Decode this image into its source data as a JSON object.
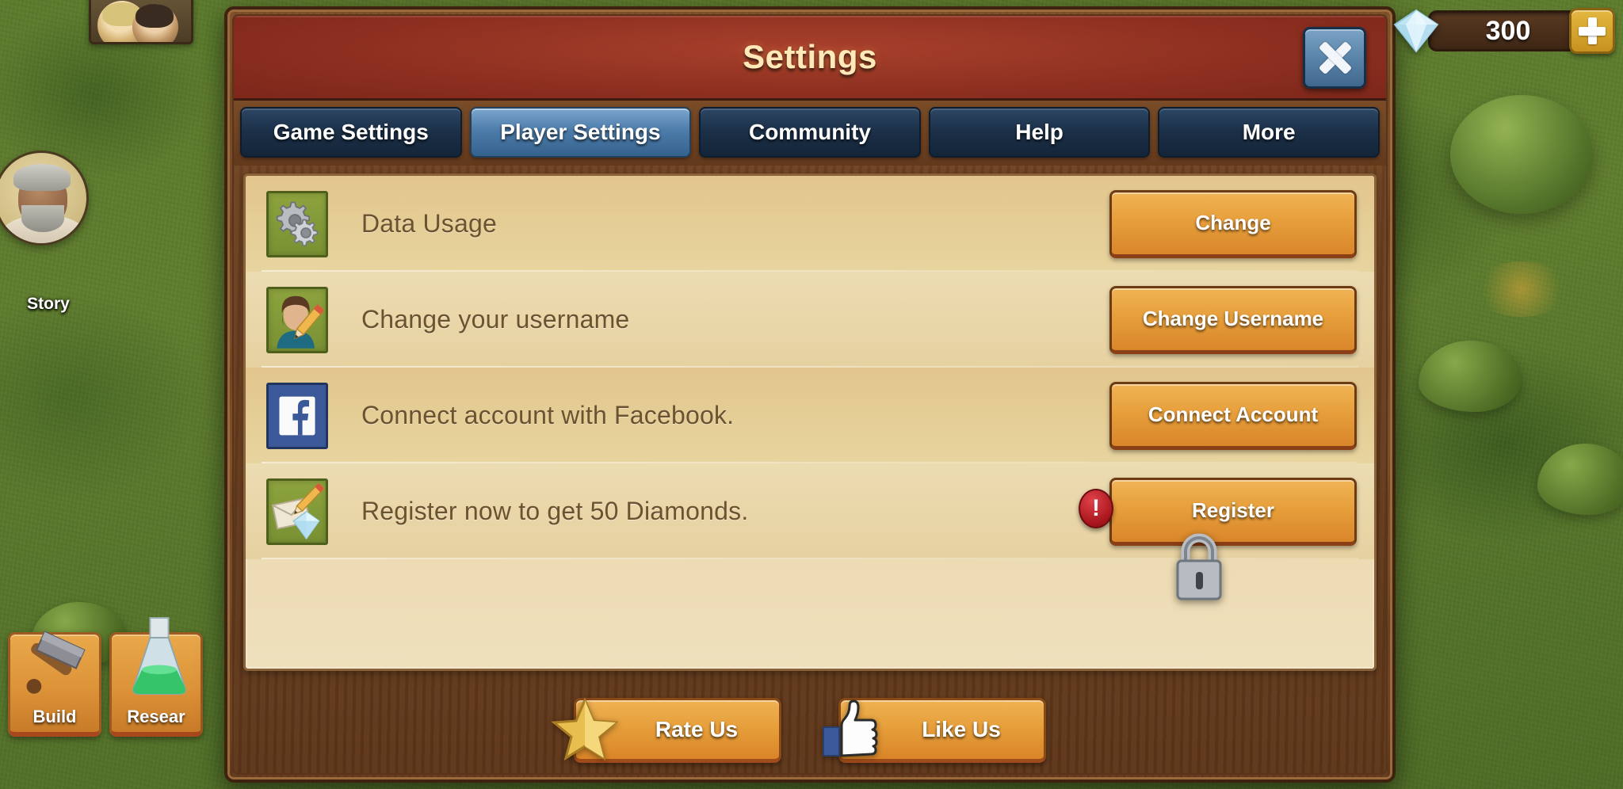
{
  "game_hud": {
    "story_label": "Story",
    "build_label": "Build",
    "research_label": "Resear",
    "diamond_count": "300",
    "alert_symbol": "!",
    "colors": {
      "grass": "#5f7d2e",
      "panel_wood": "#744724",
      "header_red": "#8d2f20",
      "orange_button": "#e79f3b",
      "tab_blue": "#1b2f47",
      "tab_active_blue": "#4e7dab",
      "facebook_blue": "#3b5998",
      "icon_green": "#8ca33e",
      "alert_red": "#a8151c"
    }
  },
  "dialog": {
    "title": "Settings",
    "close_label": "close",
    "tabs": [
      {
        "label": "Game Settings",
        "active": false
      },
      {
        "label": "Player Settings",
        "active": true
      },
      {
        "label": "Community",
        "active": false
      },
      {
        "label": "Help",
        "active": false
      },
      {
        "label": "More",
        "active": false
      }
    ],
    "rows": [
      {
        "icon": "gears-icon",
        "icon_style": "green",
        "label": "Data Usage",
        "button": "Change"
      },
      {
        "icon": "avatar-pencil-icon",
        "icon_style": "green",
        "label": "Change your username",
        "button": "Change Username"
      },
      {
        "icon": "facebook-icon",
        "icon_style": "fb",
        "label": "Connect account with Facebook.",
        "button": "Connect Account"
      },
      {
        "icon": "envelope-diamond-icon",
        "icon_style": "green",
        "label": "Register now to get 50 Diamonds.",
        "button": "Register"
      }
    ],
    "footer": [
      {
        "icon": "star-icon",
        "label": "Rate Us"
      },
      {
        "icon": "thumbs-up-icon",
        "label": "Like Us"
      }
    ]
  }
}
